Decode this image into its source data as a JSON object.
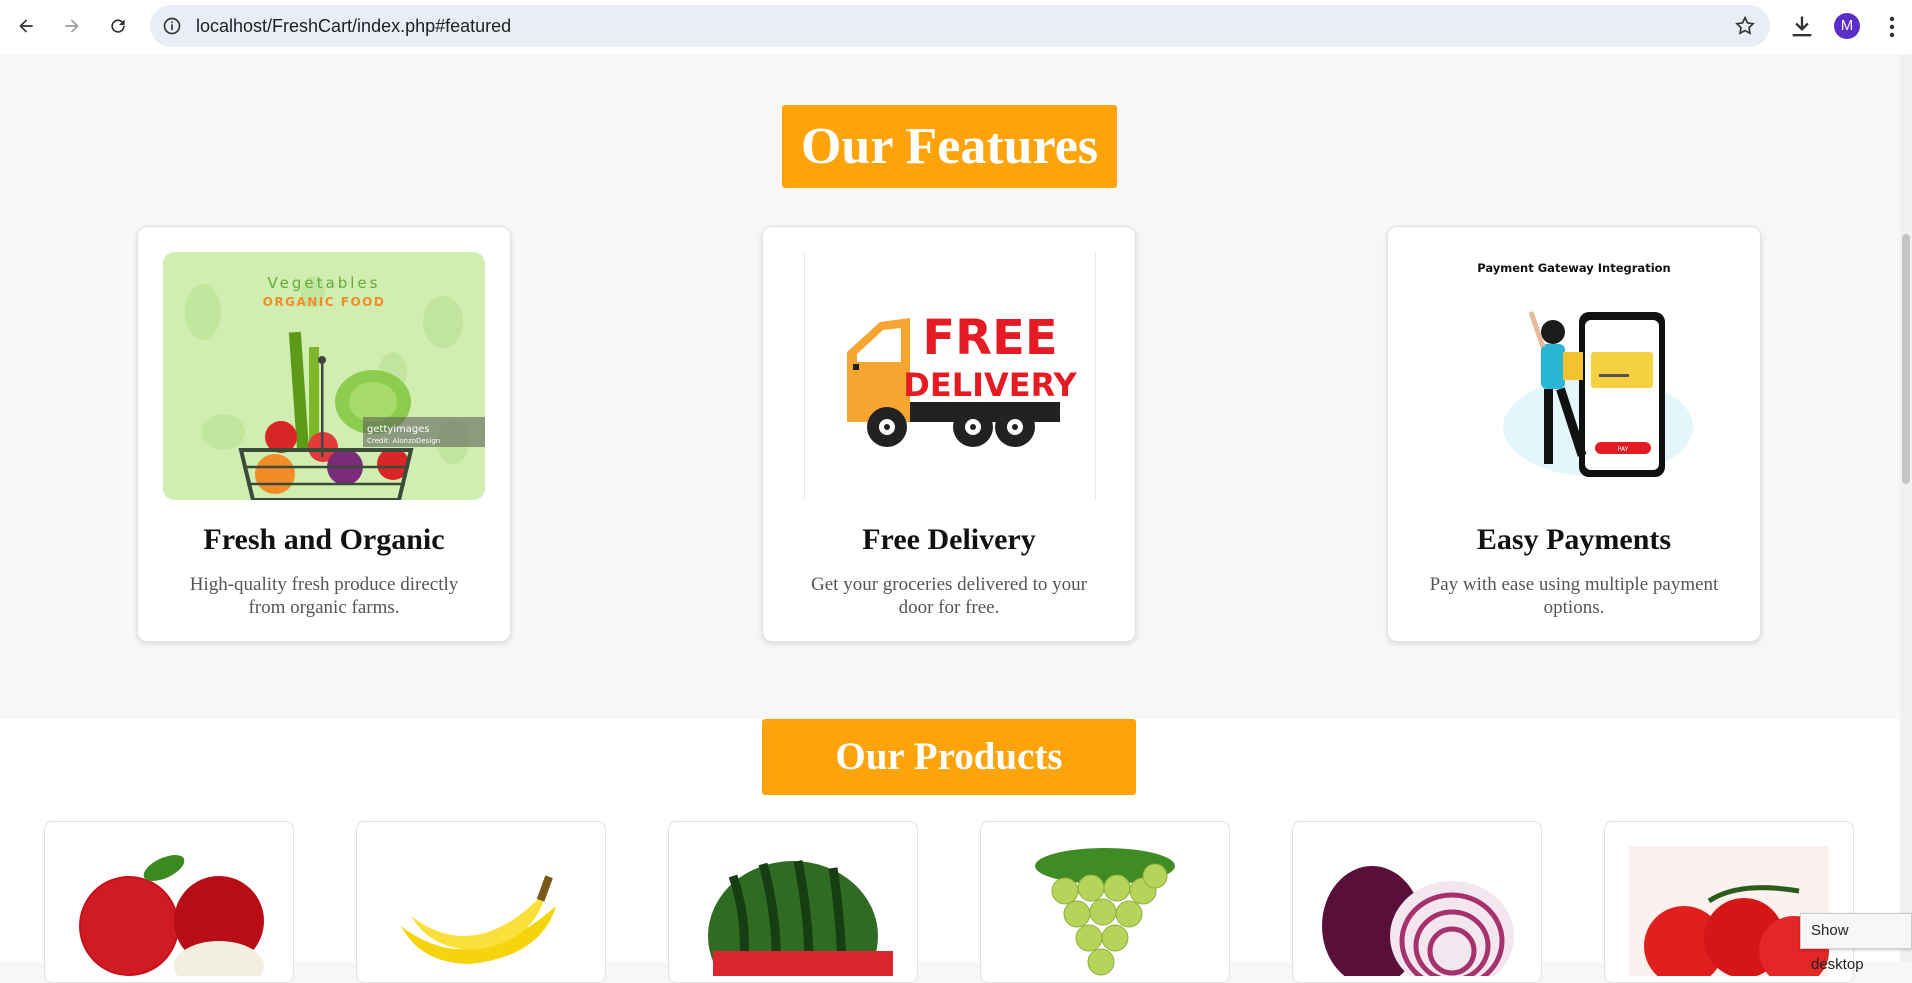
{
  "browser": {
    "url": "localhost/FreshCart/index.php#featured",
    "avatar_letter": "M",
    "icons": [
      "back-icon",
      "forward-icon",
      "reload-icon",
      "site-info-icon",
      "bookmark-star-icon",
      "download-icon",
      "kebab-menu-icon"
    ]
  },
  "features": {
    "heading": "Our Features",
    "cards": [
      {
        "title": "Fresh and Organic",
        "desc": "High-quality fresh produce directly from organic farms.",
        "img_text_1": "Vegetables",
        "img_text_2": "ORGANIC FOOD",
        "img_watermark": "gettyimages",
        "img_credit": "Credit: AlonzoDesign"
      },
      {
        "title": "Free Delivery",
        "desc": "Get your groceries delivered to your door for free.",
        "img_text_1": "FREE",
        "img_text_2": "DELIVERY"
      },
      {
        "title": "Easy Payments",
        "desc": "Pay with ease using multiple payment options.",
        "img_text_1": "Payment Gateway Integration",
        "img_text_2": "PAY"
      }
    ]
  },
  "products": {
    "heading": "Our Products",
    "items": [
      "apple",
      "banana",
      "watermelon",
      "grapes",
      "onion",
      "tomato"
    ]
  },
  "tooltip": "Show desktop",
  "colors": {
    "accent": "#fea40a",
    "avatar": "#5b2ec9"
  }
}
